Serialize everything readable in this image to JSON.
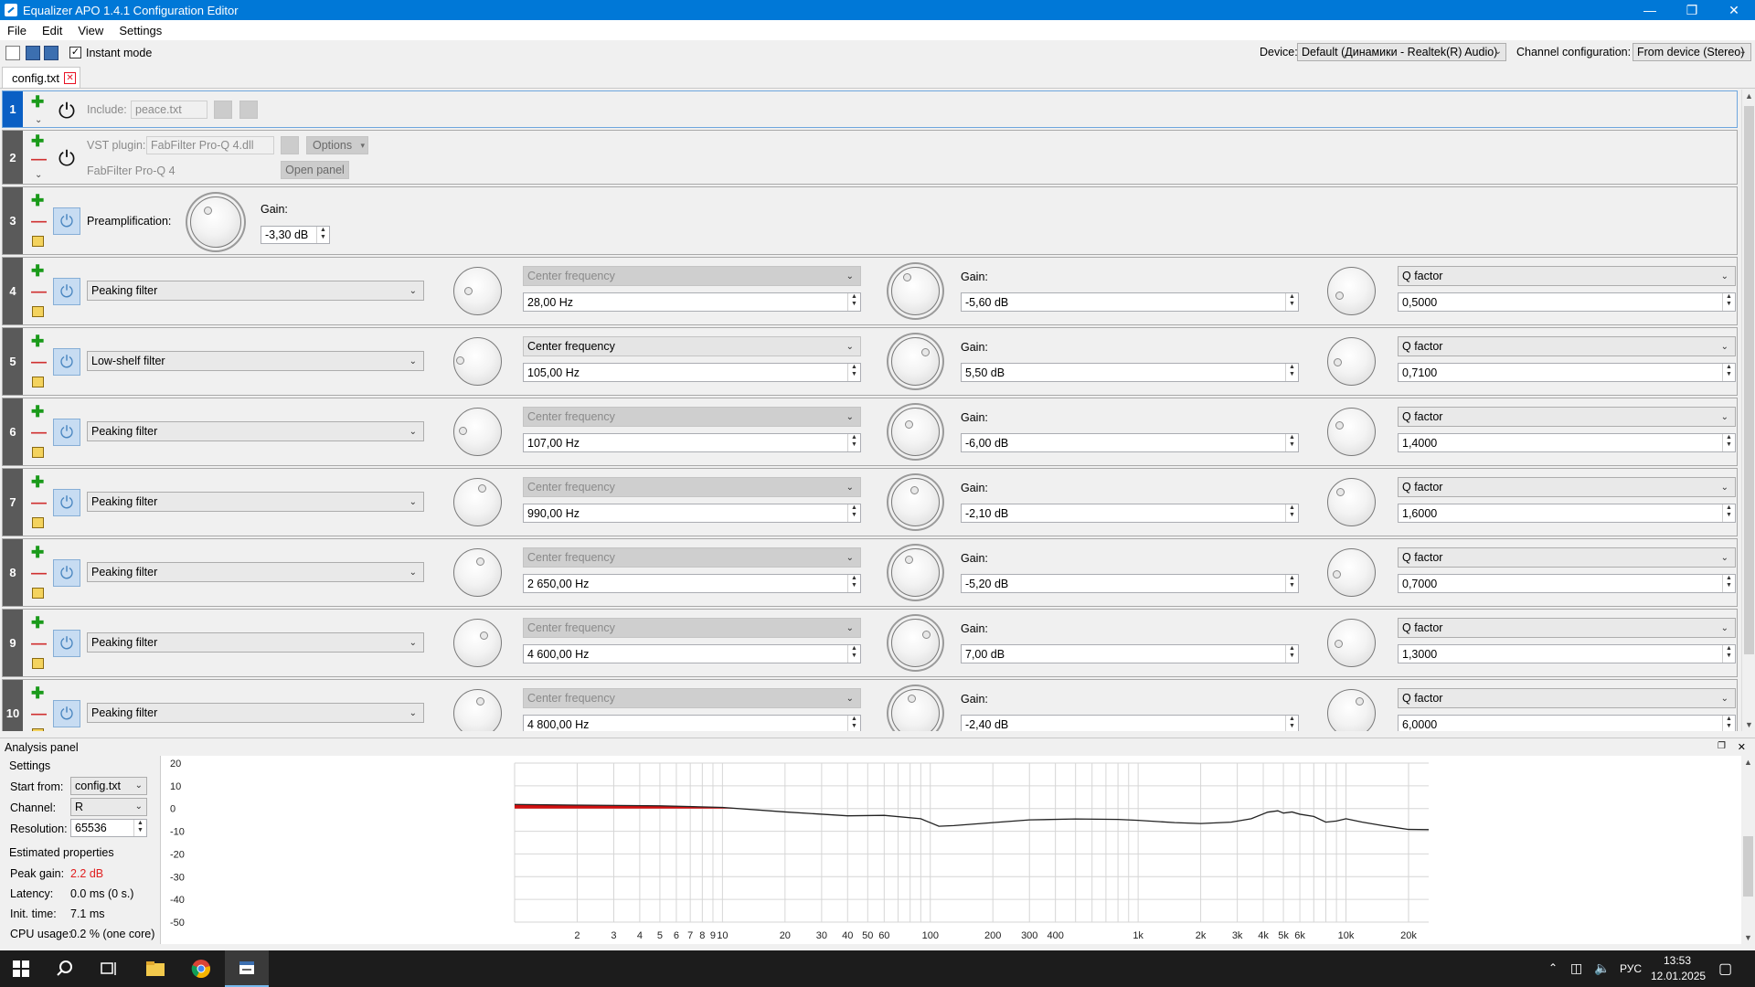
{
  "window": {
    "title": "Equalizer APO 1.4.1 Configuration Editor"
  },
  "menu": [
    "File",
    "Edit",
    "View",
    "Settings"
  ],
  "toolbar": {
    "instant_mode": "Instant mode",
    "device_label": "Device:",
    "device_value": "Default (Динамики - Realtek(R) Audio)",
    "channel_label": "Channel configuration:",
    "channel_value": "From device (Stereo)"
  },
  "tab": {
    "name": "config.txt"
  },
  "rows": {
    "r1": {
      "num": "1",
      "include_label": "Include:",
      "include_value": "peace.txt"
    },
    "r2": {
      "num": "2",
      "vst_label": "VST plugin:",
      "vst_value": "FabFilter Pro-Q 4.dll",
      "options": "Options",
      "plugin_name": "FabFilter Pro-Q 4",
      "open_panel": "Open panel"
    },
    "r3": {
      "num": "3",
      "preamp_label": "Preamplification:",
      "gain_label": "Gain:",
      "gain_value": "-3,30 dB"
    }
  },
  "filters": [
    {
      "num": "4",
      "type": "Peaking filter",
      "freq_label": "Center frequency",
      "freq": "28,00 Hz",
      "gain_label": "Gain:",
      "gain": "-5,60 dB",
      "q_label": "Q factor",
      "q": "0,5000"
    },
    {
      "num": "5",
      "type": "Low-shelf filter",
      "freq_label": "Center frequency",
      "freq": "105,00 Hz",
      "gain_label": "Gain:",
      "gain": "5,50 dB",
      "q_label": "Q factor",
      "q": "0,7100"
    },
    {
      "num": "6",
      "type": "Peaking filter",
      "freq_label": "Center frequency",
      "freq": "107,00 Hz",
      "gain_label": "Gain:",
      "gain": "-6,00 dB",
      "q_label": "Q factor",
      "q": "1,4000"
    },
    {
      "num": "7",
      "type": "Peaking filter",
      "freq_label": "Center frequency",
      "freq": "990,00 Hz",
      "gain_label": "Gain:",
      "gain": "-2,10 dB",
      "q_label": "Q factor",
      "q": "1,6000"
    },
    {
      "num": "8",
      "type": "Peaking filter",
      "freq_label": "Center frequency",
      "freq": "2 650,00 Hz",
      "gain_label": "Gain:",
      "gain": "-5,20 dB",
      "q_label": "Q factor",
      "q": "0,7000"
    },
    {
      "num": "9",
      "type": "Peaking filter",
      "freq_label": "Center frequency",
      "freq": "4 600,00 Hz",
      "gain_label": "Gain:",
      "gain": "7,00 dB",
      "q_label": "Q factor",
      "q": "1,3000"
    },
    {
      "num": "10",
      "type": "Peaking filter",
      "freq_label": "Center frequency",
      "freq": "4 800,00 Hz",
      "gain_label": "Gain:",
      "gain": "-2,40 dB",
      "q_label": "Q factor",
      "q": "6,0000"
    }
  ],
  "analysis": {
    "title": "Analysis panel",
    "settings": "Settings",
    "start_from_label": "Start from:",
    "start_from": "config.txt",
    "channel_label": "Channel:",
    "channel": "R",
    "resolution_label": "Resolution:",
    "resolution": "65536",
    "estimated": "Estimated properties",
    "peak_gain_label": "Peak gain:",
    "peak_gain": "2.2 dB",
    "latency_label": "Latency:",
    "latency": "0.0 ms (0 s.)",
    "init_label": "Init. time:",
    "init": "7.1 ms",
    "cpu_label": "CPU usage:",
    "cpu": "0.2 % (one core)",
    "peak_color": "#e02020"
  },
  "chart_data": {
    "type": "line",
    "x_scale": "log",
    "xlim": [
      1,
      25000
    ],
    "ylim": [
      -50,
      20
    ],
    "y_ticks": [
      "20",
      "10",
      "0",
      "-10",
      "-20",
      "-30",
      "-40",
      "-50"
    ],
    "x_ticks": [
      {
        "v": 2,
        "t": "2"
      },
      {
        "v": 3,
        "t": "3"
      },
      {
        "v": 4,
        "t": "4"
      },
      {
        "v": 5,
        "t": "5"
      },
      {
        "v": 6,
        "t": "6"
      },
      {
        "v": 7,
        "t": "7"
      },
      {
        "v": 8,
        "t": "8"
      },
      {
        "v": 9,
        "t": "9"
      },
      {
        "v": 10,
        "t": "10"
      },
      {
        "v": 20,
        "t": "20"
      },
      {
        "v": 30,
        "t": "30"
      },
      {
        "v": 40,
        "t": "40"
      },
      {
        "v": 50,
        "t": "50"
      },
      {
        "v": 60,
        "t": "60"
      },
      {
        "v": 100,
        "t": "100"
      },
      {
        "v": 200,
        "t": "200"
      },
      {
        "v": 300,
        "t": "300"
      },
      {
        "v": 400,
        "t": "400"
      },
      {
        "v": 1000,
        "t": "1k"
      },
      {
        "v": 2000,
        "t": "2k"
      },
      {
        "v": 3000,
        "t": "3k"
      },
      {
        "v": 4000,
        "t": "4k"
      },
      {
        "v": 5000,
        "t": "5k"
      },
      {
        "v": 6000,
        "t": "6k"
      },
      {
        "v": 10000,
        "t": "10k"
      },
      {
        "v": 20000,
        "t": "20k"
      }
    ],
    "series": [
      {
        "color": "#222222",
        "x": [
          1,
          2,
          5,
          10,
          20,
          40,
          60,
          90,
          110,
          130,
          200,
          300,
          500,
          800,
          1000,
          1500,
          2000,
          2800,
          3500,
          4200,
          4700,
          5000,
          5500,
          6000,
          7000,
          8000,
          9000,
          10000,
          12000,
          15000,
          20000,
          25000
        ],
        "y": [
          1.8,
          1.5,
          1.2,
          0.5,
          -1.5,
          -3.2,
          -3.0,
          -4.5,
          -7.8,
          -7.5,
          -6.2,
          -5.0,
          -4.6,
          -4.8,
          -5.2,
          -6.2,
          -6.6,
          -6.0,
          -4.5,
          -1.6,
          -1.0,
          -2.0,
          -1.5,
          -2.5,
          -3.5,
          -6.0,
          -5.5,
          -4.5,
          -6.0,
          -7.5,
          -9.2,
          -9.3
        ]
      }
    ],
    "clip_threshold_db": 0,
    "clip_color": "#d01010"
  },
  "taskbar": {
    "lang": "РУС",
    "time": "13:53",
    "date": "12.01.2025"
  }
}
